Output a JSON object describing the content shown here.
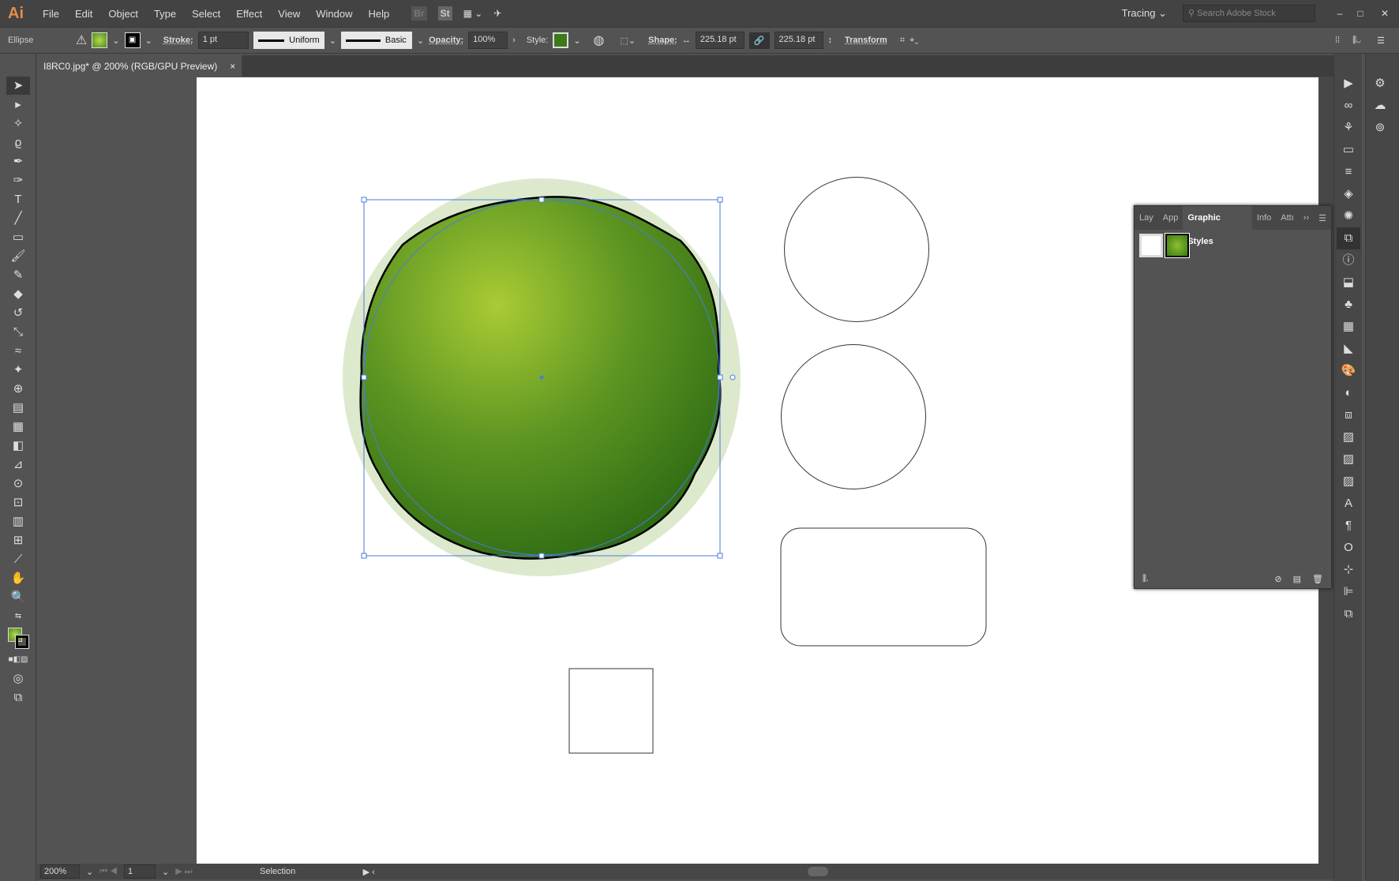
{
  "app": {
    "logo": "Ai",
    "menus": [
      "File",
      "Edit",
      "Object",
      "Type",
      "Select",
      "Effect",
      "View",
      "Window",
      "Help"
    ],
    "bridge": "Br",
    "stock": "St",
    "workspace": "Tracing",
    "search_placeholder": "Search Adobe Stock"
  },
  "control": {
    "object_type": "Ellipse",
    "stroke_label": "Stroke:",
    "stroke_value": "1 pt",
    "profile": "Uniform",
    "brush": "Basic",
    "opacity_label": "Opacity:",
    "opacity_value": "100%",
    "style_label": "Style:",
    "shape_label": "Shape:",
    "width": "225.18 pt",
    "height": "225.18 pt",
    "transform": "Transform",
    "fill_color": "#6aa52a"
  },
  "document": {
    "tab_title": "I8RC0.jpg* @ 200% (RGB/GPU Preview)",
    "close": "×"
  },
  "status": {
    "zoom": "200%",
    "page": "1",
    "tool": "Selection"
  },
  "graphic_styles": {
    "tabs": [
      "Lay",
      "App",
      "Graphic Styles",
      "Info",
      "Attı"
    ],
    "active_tab": "Graphic Styles"
  }
}
